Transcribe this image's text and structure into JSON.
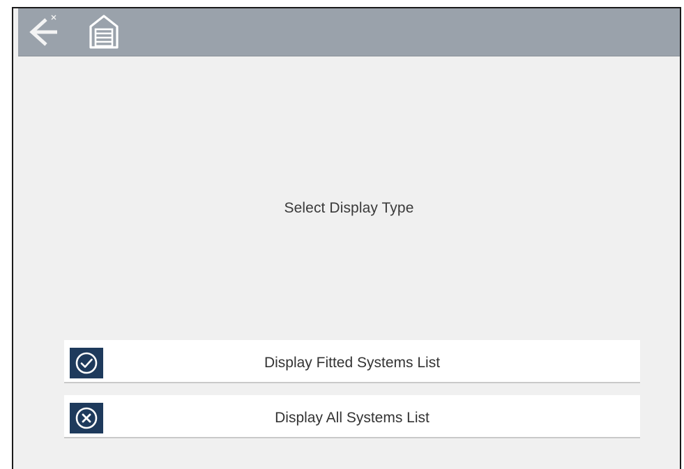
{
  "toolbar": {
    "back_icon": "back-arrow-icon",
    "home_icon": "garage-home-icon"
  },
  "main": {
    "title": "Select Display Type",
    "options": [
      {
        "label": "Display Fitted Systems List",
        "icon": "check-circle-icon"
      },
      {
        "label": "Display All Systems List",
        "icon": "x-circle-icon"
      }
    ]
  },
  "colors": {
    "toolbar_bg": "#9aa2ab",
    "content_bg": "#f0f0f0",
    "icon_box": "#1e3a5c",
    "option_bg": "#ffffff"
  }
}
